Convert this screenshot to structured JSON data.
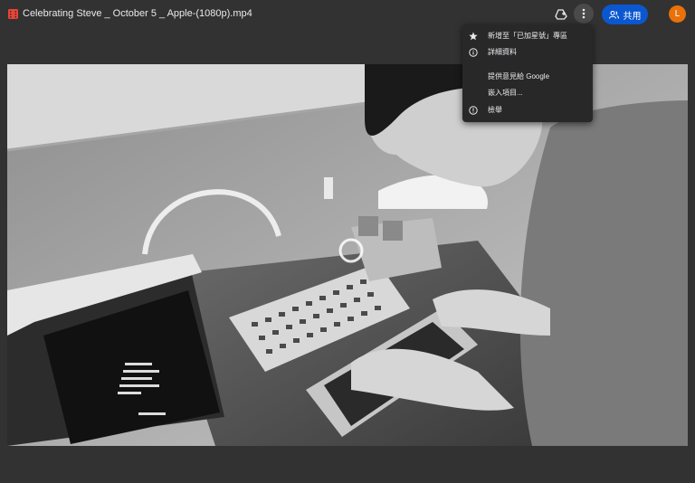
{
  "file": {
    "title": "Celebrating Steve _ October 5 _ Apple-(1080p).mp4",
    "icon": "video-file-icon",
    "icon_color": "#ea4335"
  },
  "toolbar": {
    "add_to_drive_icon": "add-to-drive-icon",
    "more_icon": "more-vert-icon",
    "share_label": "共用",
    "share_icon": "people-icon",
    "avatar_letter": "L",
    "accent": "#0b57d0",
    "avatar_color": "#e8710a"
  },
  "menu": {
    "items": [
      {
        "label": "新增至「已加星號」專區",
        "icon": "star-icon"
      },
      {
        "label": "詳細資料",
        "icon": "info-icon"
      },
      {
        "label": "提供意見給 Google",
        "icon": ""
      },
      {
        "label": "嵌入項目...",
        "icon": ""
      },
      {
        "label": "檢舉",
        "icon": "report-icon"
      }
    ]
  },
  "player": {
    "control_icon": "loading-ring-icon"
  }
}
